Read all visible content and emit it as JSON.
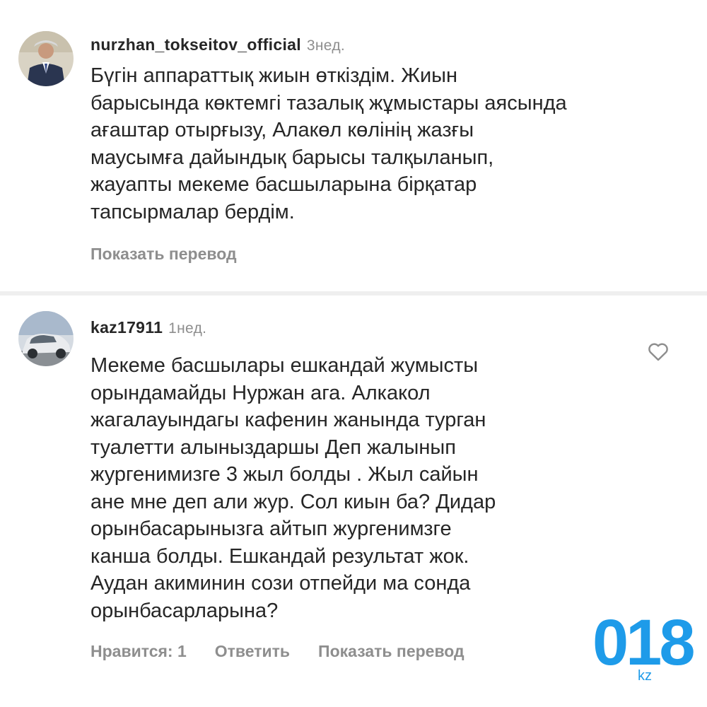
{
  "comments": [
    {
      "username": "nurzhan_tokseitov_official",
      "time": "3нед.",
      "text": "Бүгін аппараттық жиын өткіздім. Жиын\nбарысында көктемгі тазалық жұмыстары аясында\nағаштар отырғызу, Алакөл көлінің жазғы\nмаусымға дайындық барысы талқыланып,\nжауапты мекеме басшыларына бірқатар\nтапсырмалар бердім.",
      "translate_label": "Показать перевод"
    },
    {
      "username": "kaz17911",
      "time": "1нед.",
      "text": "Мекеме басшылары ешкандай жумысты\nорындамайды Нуржан ага. Алкакол\nжагалауындагы кафенин жанында турган\nтуалетти алыныздаршы Деп жалынып\nжургенимизге 3 жыл болды . Жыл сайын\nане мне деп али жур. Сол киын ба? Дидар\nорынбасарынызга айтып жургенимзге\nканша болды. Ешкандай результат жок.\nАудан акиминин сози отпейди ма сонда\nорынбасарларына?",
      "likes_label": "Нравится: 1",
      "reply_label": "Ответить",
      "translate_label": "Показать перевод",
      "icon": "heart-outline-icon"
    }
  ],
  "watermark": {
    "text": "018",
    "suffix": "kz",
    "color": "#1e9be9"
  }
}
